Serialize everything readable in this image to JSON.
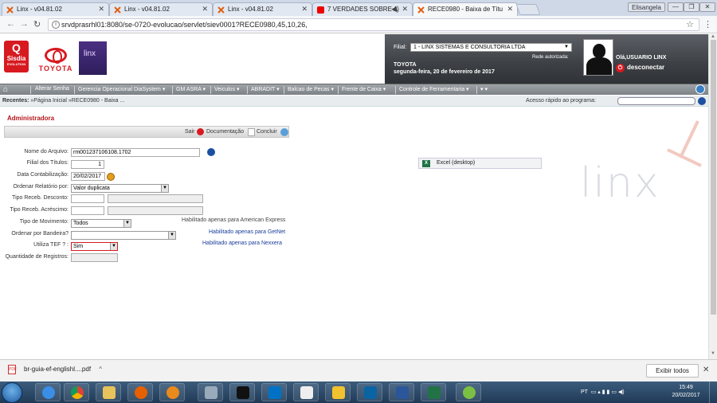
{
  "browser": {
    "tabs": [
      {
        "label": "Linx - v04.81.02",
        "icon": "linx-x-icon"
      },
      {
        "label": "Linx - v04.81.02",
        "icon": "linx-x-icon"
      },
      {
        "label": "Linx - v04.81.02",
        "icon": "linx-x-icon"
      },
      {
        "label": "7 VERDADES SOBRE A",
        "icon": "youtube-icon"
      },
      {
        "label": "RECE0980 - Baixa de Títu",
        "icon": "linx-x-icon"
      }
    ],
    "user_button": "Elisangela",
    "url": "srvdprasrhl01:8080/se-0720-evolucao/servlet/siev0001?RECE0980,45,10,26,"
  },
  "header": {
    "sisdia_q": "Q",
    "sisdia_name": "Sisdia",
    "sisdia_sub": "EVOLUTION",
    "toyota": "TOYOTA",
    "linx_logo": "linx",
    "filial_label": "Filial:",
    "filial_value": "1 - LINX SISTEMAS E CONSULTORIA LTDA",
    "rede": "Rede autorizada:",
    "company": "TOYOTA",
    "date": "segunda-feira, 20 de fevereiro de 2017",
    "user": "Olá,USUARIO LINX",
    "logout": "desconectar"
  },
  "menu": {
    "items": [
      "Alterar Senha",
      "Gerencia Operacional DiaSystem ▾",
      "GM ASRA ▾",
      "Veiculos ▾",
      "ABRADIT ▾",
      "Balcao de Pecas ▾",
      "Frente de Caixa ▾",
      "Controle de Ferramentaria ▾",
      "▾ ▾"
    ]
  },
  "recent": {
    "label": "Recentes:",
    "path": " »Página Inicial »RECE0980 - Baixa ...",
    "quick": "Acesso rápido ao programa:"
  },
  "section_title": "Administradora",
  "actions": {
    "exit": "Sair",
    "docs": "Documentação",
    "finish": "Concluir"
  },
  "form": {
    "nome_arquivo": {
      "label": "Nome do Arquivo:",
      "value": "rm001237106108.1702"
    },
    "filial_titulos": {
      "label": "Filial dos Títulos:",
      "value": "1"
    },
    "data_contab": {
      "label": "Data Contabilização:",
      "value": "20/02/2017"
    },
    "ordenar_rel": {
      "label": "Ordenar Relatório por:",
      "value": "Valor duplicata"
    },
    "tipo_desc": {
      "label": "Tipo Receb. Desconto:"
    },
    "tipo_acr": {
      "label": "Tipo Receb. Acréscimo:"
    },
    "tipo_mov": {
      "label": "Tipo de Movimento:",
      "value": "Todos"
    },
    "ordenar_band": {
      "label": "Ordenar por Bandeira?",
      "value": ""
    },
    "utiliza_tef": {
      "label": "Utiliza TEF ? :",
      "value": "Sim"
    },
    "qtd_reg": {
      "label": "Quantidade de Registros:"
    }
  },
  "notes": {
    "amex": "Habilitado apenas para American Express",
    "getnet": "Habilitado apenas para GetNet",
    "nexxera": "Habilitado apenas para Nexxera"
  },
  "excel": "Excel (desktop)",
  "watermark": "linx",
  "download": {
    "file": "br-guia-ef-englishl....pdf",
    "show_all": "Exibir todos"
  },
  "taskbar": {
    "lang": "PT",
    "time": "15:49",
    "date": "20/02/2017"
  },
  "colors": {
    "accent_red": "#d71920",
    "link_blue": "#1a3d9c",
    "header_dark": "#3d4045"
  }
}
